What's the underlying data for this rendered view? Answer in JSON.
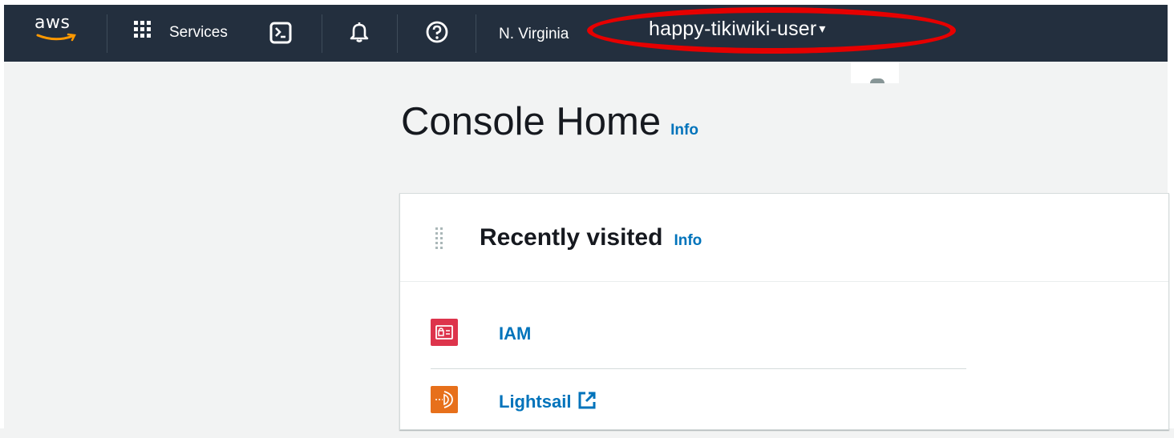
{
  "topnav": {
    "logo_text": "aws",
    "services_label": "Services",
    "region": "N. Virginia",
    "user_name": "happy-tikiwiki-user",
    "user_caret": "▾",
    "icons": [
      "aws-logo",
      "grid-icon",
      "cloudshell-icon",
      "bell-icon",
      "help-icon"
    ]
  },
  "page": {
    "title": "Console Home",
    "info": "Info"
  },
  "recently_visited": {
    "title": "Recently visited",
    "info": "Info",
    "items": [
      {
        "label": "IAM",
        "icon": "iam-icon",
        "color": "#dd344c"
      },
      {
        "label": "Lightsail",
        "icon": "lightsail-icon",
        "color": "#e7701b",
        "external": true
      }
    ]
  },
  "colors": {
    "nav_bg": "#232f3e",
    "link": "#0073bb",
    "annotation": "#e60000"
  }
}
